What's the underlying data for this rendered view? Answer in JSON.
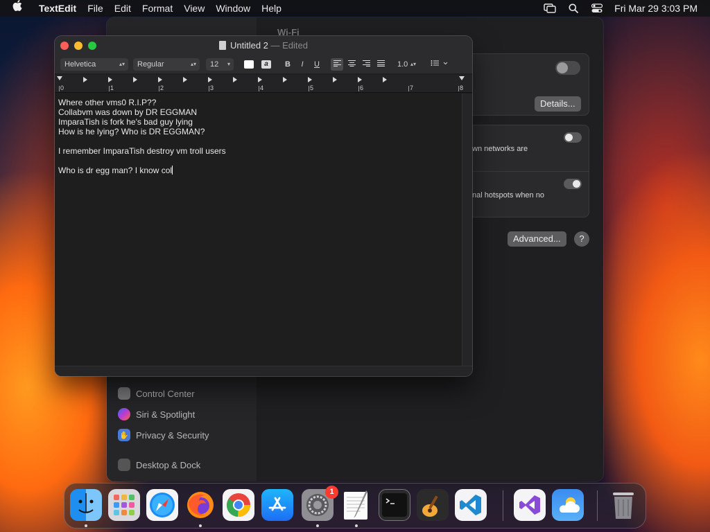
{
  "menubar": {
    "app_name": "TextEdit",
    "items": [
      "File",
      "Edit",
      "Format",
      "View",
      "Window",
      "Help"
    ],
    "clock": "Fri Mar 29  3:03 PM"
  },
  "settings": {
    "title": "Wi-Fi",
    "details_button": "Details...",
    "networks_text": "wn networks are",
    "hotspots_text": "nal hotspots when no",
    "advanced_button": "Advanced...",
    "help_button": "?",
    "sidebar": [
      "Control Center",
      "Siri & Spotlight",
      "Privacy & Security",
      "Desktop & Dock"
    ]
  },
  "textedit": {
    "doc_name": "Untitled 2",
    "separator": "—",
    "status": "Edited",
    "toolbar": {
      "font_family": "Helvetica",
      "font_style": "Regular",
      "font_size": "12",
      "spacing": "1.0",
      "bold": "B",
      "italic": "I",
      "underline": "U"
    },
    "ruler_numbers": [
      "0",
      "1",
      "2",
      "3",
      "4",
      "5",
      "6",
      "7",
      "8"
    ],
    "lines": [
      "Where other vms0 R.I.P??",
      "Collabvm was down by DR EGGMAN",
      "ImparaTish is fork he's bad guy lying",
      "How is he lying? Who is DR EGGMAN?",
      "",
      "I remember ImparaTish destroy vm troll users",
      "",
      "Who is dr egg man? I know col"
    ]
  },
  "dock": {
    "apps": [
      "Finder",
      "Launchpad",
      "Safari",
      "Firefox",
      "Chrome",
      "App Store",
      "System Settings",
      "TextEdit",
      "Terminal",
      "GarageBand",
      "Visual Studio Code",
      "Visual Studio",
      "Weather",
      "Trash"
    ],
    "settings_badge": "1"
  }
}
